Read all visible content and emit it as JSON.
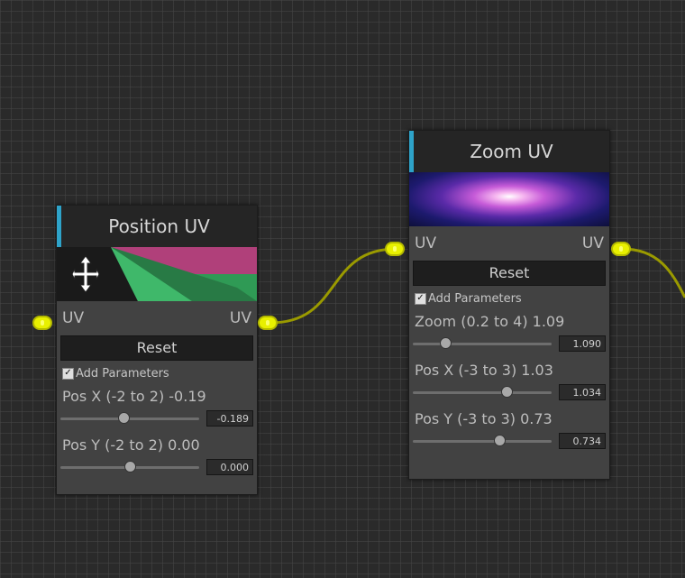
{
  "colors": {
    "accent": "#2ea3c9",
    "port": "#e8f000",
    "wire": "#9a9a00",
    "node_bg": "#424242",
    "header_bg": "#252525"
  },
  "nodes": [
    {
      "title": "Position UV",
      "preview_icon": "move-arrows-icon",
      "port_in": "UV",
      "port_out": "UV",
      "reset_label": "Reset",
      "add_params_label": "Add Parameters",
      "add_params_checked": true,
      "params": [
        {
          "label": "Pos X (-2 to 2) -0.19",
          "value": "-0.189",
          "min": -2,
          "max": 2,
          "current": -0.189
        },
        {
          "label": "Pos Y (-2 to 2) 0.00",
          "value": "0.000",
          "min": -2,
          "max": 2,
          "current": 0.0
        }
      ]
    },
    {
      "title": "Zoom UV",
      "preview_icon": "nebula-image",
      "port_in": "UV",
      "port_out": "UV",
      "reset_label": "Reset",
      "add_params_label": "Add Parameters",
      "add_params_checked": true,
      "params": [
        {
          "label": "Zoom (0.2 to 4) 1.09",
          "value": "1.090",
          "min": 0.2,
          "max": 4,
          "current": 1.09
        },
        {
          "label": "Pos X (-3 to 3) 1.03",
          "value": "1.034",
          "min": -3,
          "max": 3,
          "current": 1.034
        },
        {
          "label": "Pos Y (-3 to 3) 0.73",
          "value": "0.734",
          "min": -3,
          "max": 3,
          "current": 0.734
        }
      ]
    }
  ]
}
